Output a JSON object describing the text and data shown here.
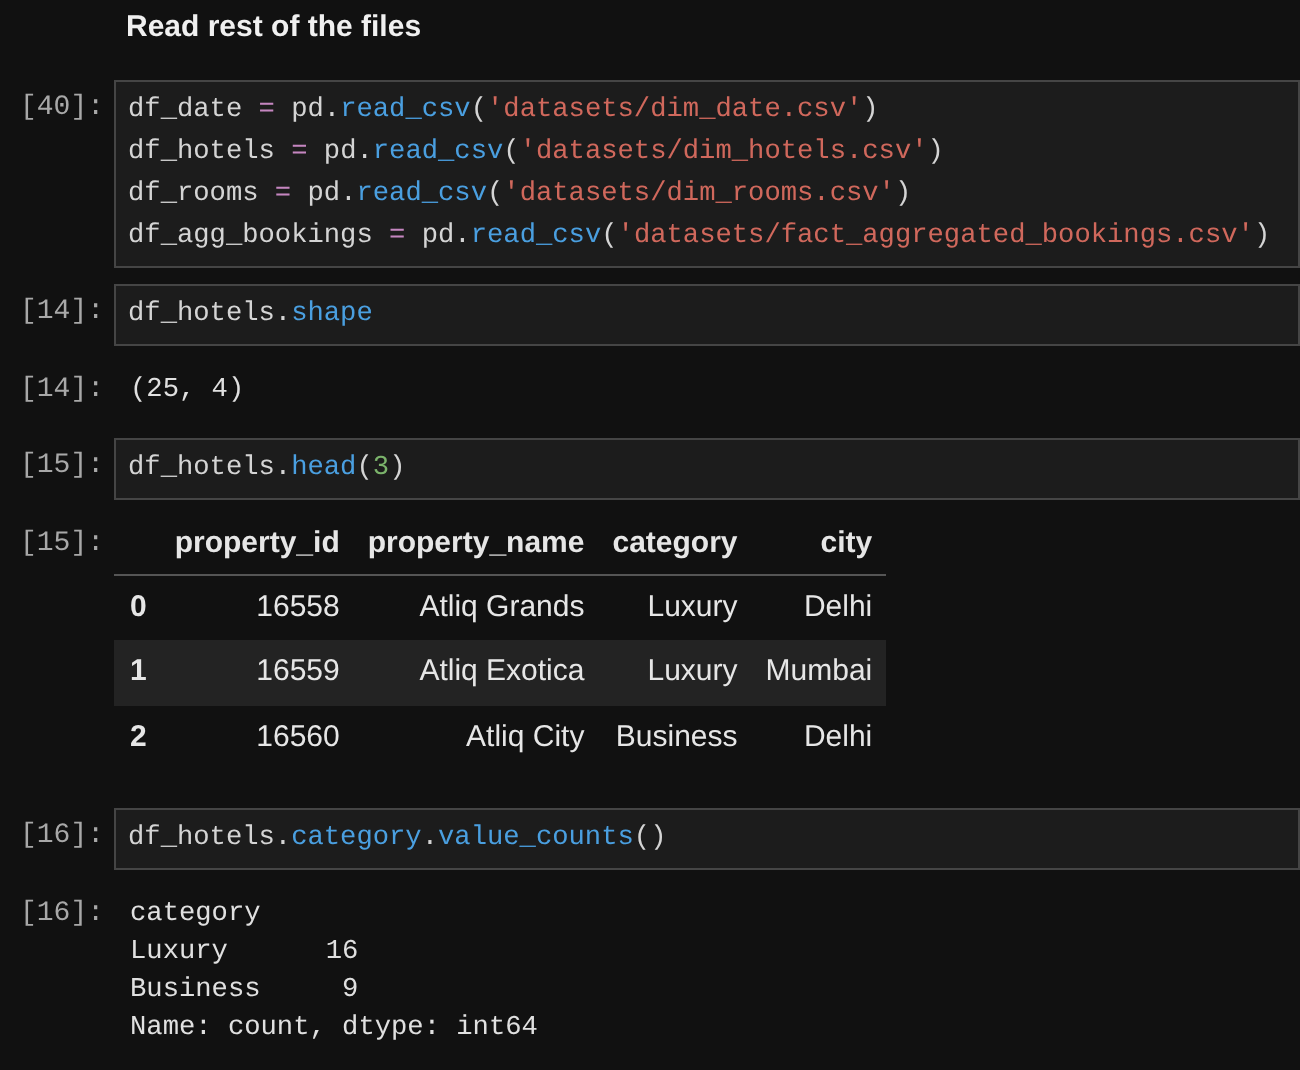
{
  "heading": "Read rest of the files",
  "cells": [
    {
      "kind": "code",
      "prompt": "[40]:",
      "lines": [
        [
          {
            "kind": "plain",
            "text": "df_date "
          },
          {
            "kind": "op",
            "text": "="
          },
          {
            "kind": "plain",
            "text": " pd."
          },
          {
            "kind": "func",
            "text": "read_csv"
          },
          {
            "kind": "plain",
            "text": "("
          },
          {
            "kind": "string",
            "text": "'datasets/dim_date.csv'"
          },
          {
            "kind": "plain",
            "text": ")"
          }
        ],
        [
          {
            "kind": "plain",
            "text": "df_hotels "
          },
          {
            "kind": "op",
            "text": "="
          },
          {
            "kind": "plain",
            "text": " pd."
          },
          {
            "kind": "func",
            "text": "read_csv"
          },
          {
            "kind": "plain",
            "text": "("
          },
          {
            "kind": "string",
            "text": "'datasets/dim_hotels.csv'"
          },
          {
            "kind": "plain",
            "text": ")"
          }
        ],
        [
          {
            "kind": "plain",
            "text": "df_rooms "
          },
          {
            "kind": "op",
            "text": "="
          },
          {
            "kind": "plain",
            "text": " pd."
          },
          {
            "kind": "func",
            "text": "read_csv"
          },
          {
            "kind": "plain",
            "text": "("
          },
          {
            "kind": "string",
            "text": "'datasets/dim_rooms.csv'"
          },
          {
            "kind": "plain",
            "text": ")"
          }
        ],
        [
          {
            "kind": "plain",
            "text": "df_agg_bookings "
          },
          {
            "kind": "op",
            "text": "="
          },
          {
            "kind": "plain",
            "text": " pd."
          },
          {
            "kind": "func",
            "text": "read_csv"
          },
          {
            "kind": "plain",
            "text": "("
          },
          {
            "kind": "string",
            "text": "'datasets/fact_aggregated_bookings.csv'"
          },
          {
            "kind": "plain",
            "text": ")"
          }
        ]
      ]
    },
    {
      "kind": "code",
      "prompt": "[14]:",
      "lines": [
        [
          {
            "kind": "plain",
            "text": "df_hotels."
          },
          {
            "kind": "func",
            "text": "shape"
          }
        ]
      ]
    },
    {
      "kind": "text_output",
      "prompt": "[14]:",
      "lines": [
        "(25, 4)"
      ]
    },
    {
      "kind": "code",
      "prompt": "[15]:",
      "lines": [
        [
          {
            "kind": "plain",
            "text": "df_hotels."
          },
          {
            "kind": "func",
            "text": "head"
          },
          {
            "kind": "plain",
            "text": "("
          },
          {
            "kind": "number",
            "text": "3"
          },
          {
            "kind": "plain",
            "text": ")"
          }
        ]
      ]
    },
    {
      "kind": "table_output",
      "prompt": "[15]:",
      "columns": [
        "property_id",
        "property_name",
        "category",
        "city"
      ],
      "rows": [
        {
          "index": "0",
          "cells": [
            "16558",
            "Atliq Grands",
            "Luxury",
            "Delhi"
          ]
        },
        {
          "index": "1",
          "cells": [
            "16559",
            "Atliq Exotica",
            "Luxury",
            "Mumbai"
          ]
        },
        {
          "index": "2",
          "cells": [
            "16560",
            "Atliq City",
            "Business",
            "Delhi"
          ]
        }
      ]
    },
    {
      "kind": "code",
      "prompt": "[16]:",
      "lines": [
        [
          {
            "kind": "plain",
            "text": "df_hotels."
          },
          {
            "kind": "func",
            "text": "category"
          },
          {
            "kind": "plain",
            "text": "."
          },
          {
            "kind": "func",
            "text": "value_counts"
          },
          {
            "kind": "plain",
            "text": "()"
          }
        ]
      ]
    },
    {
      "kind": "text_output",
      "prompt": "[16]:",
      "lines": [
        "category",
        "Luxury      16",
        "Business     9",
        "Name: count, dtype: int64"
      ]
    }
  ]
}
